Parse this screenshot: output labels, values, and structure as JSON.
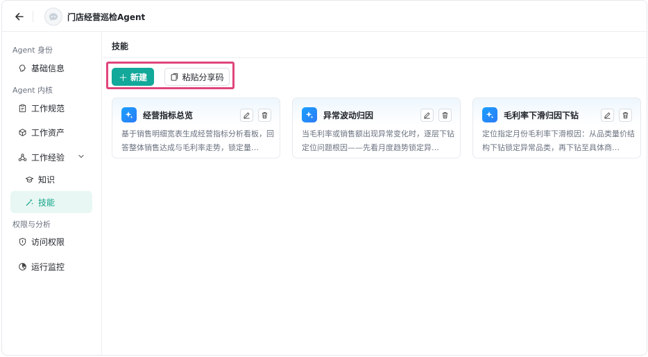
{
  "header": {
    "title": "门店经营巡检Agent"
  },
  "sidebar": {
    "sections": [
      {
        "label": "Agent 身份"
      },
      {
        "label": "Agent 内核"
      },
      {
        "label": "权限与分析"
      }
    ],
    "items": [
      {
        "label": "基础信息",
        "icon": "brain-icon"
      },
      {
        "label": "工作规范",
        "icon": "clipboard-icon"
      },
      {
        "label": "工作资产",
        "icon": "cube-icon"
      },
      {
        "label": "工作经验",
        "icon": "network-icon"
      },
      {
        "label": "知识",
        "icon": "graduation-cap-icon"
      },
      {
        "label": "技能",
        "icon": "sparkle-wand-icon"
      },
      {
        "label": "访问权限",
        "icon": "shield-icon"
      },
      {
        "label": "运行监控",
        "icon": "monitor-gauge-icon"
      }
    ],
    "active_item": "技能"
  },
  "main": {
    "title": "技能",
    "new_label": "新建",
    "paste_label": "粘贴分享码",
    "highlight_color": "#e0457b",
    "accent_color": "#12a89a",
    "cards": [
      {
        "title": "经营指标总览",
        "desc": "基于销售明细宽表生成经营指标分析看板，回答整体销售达成与毛利率走势，锁定量…"
      },
      {
        "title": "异常波动归因",
        "desc": "当毛利率或销售额出现异常变化时，逐层下钻定位问题根因——先看月度趋势锁定异…"
      },
      {
        "title": "毛利率下滑归因下钻",
        "desc": "定位指定月份毛利率下滑根因：从品类量价结构下钻锁定异常品类，再下钻至具体商…"
      }
    ]
  }
}
